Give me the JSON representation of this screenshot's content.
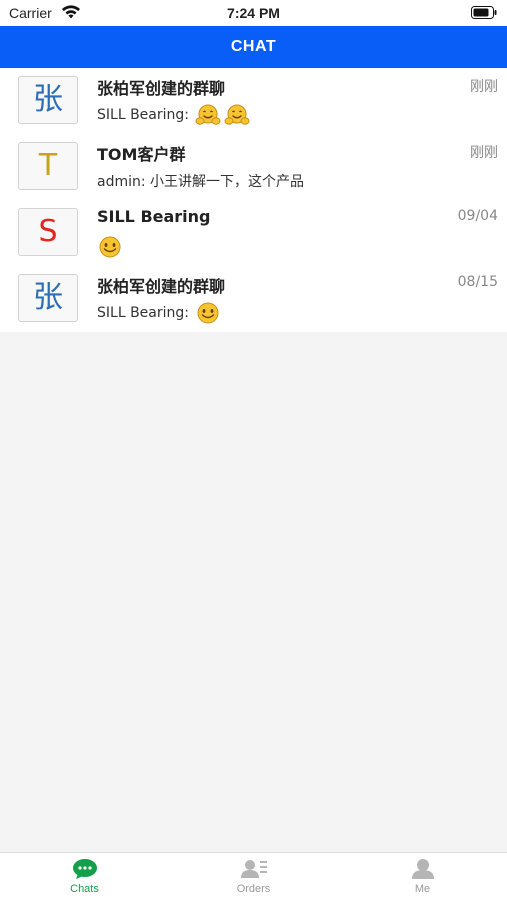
{
  "status_bar": {
    "carrier": "Carrier",
    "time": "7:24 PM"
  },
  "header": {
    "title": "CHAT"
  },
  "chats": [
    {
      "avatar_letter": "张",
      "avatar_color": "#2f6db5",
      "name": "张柏军创建的群聊",
      "time": "刚刚",
      "preview": "SILL Bearing:",
      "emojis": [
        "hugging-emoji",
        "hugging-emoji"
      ]
    },
    {
      "avatar_letter": "T",
      "avatar_color": "#c9a21b",
      "name": "TOM客户群",
      "time": "刚刚",
      "preview": "admin: 小王讲解一下，这个产品",
      "emojis": []
    },
    {
      "avatar_letter": "S",
      "avatar_color": "#e0281f",
      "name": "SILL Bearing",
      "time": "09/04",
      "preview": "",
      "emojis": [
        "smile-emoji"
      ]
    },
    {
      "avatar_letter": "张",
      "avatar_color": "#2f6db5",
      "name": "张柏军创建的群聊",
      "time": "08/15",
      "preview": "SILL Bearing:",
      "emojis": [
        "smile-emoji"
      ]
    }
  ],
  "tab_bar": {
    "tabs": [
      {
        "label": "Chats",
        "icon": "chat-bubble-icon",
        "active": true
      },
      {
        "label": "Orders",
        "icon": "orders-icon",
        "active": false
      },
      {
        "label": "Me",
        "icon": "person-icon",
        "active": false
      }
    ]
  },
  "colors": {
    "header_bg": "#0a5ef8",
    "active_tab": "#14a04a",
    "inactive_tab": "#999999"
  }
}
